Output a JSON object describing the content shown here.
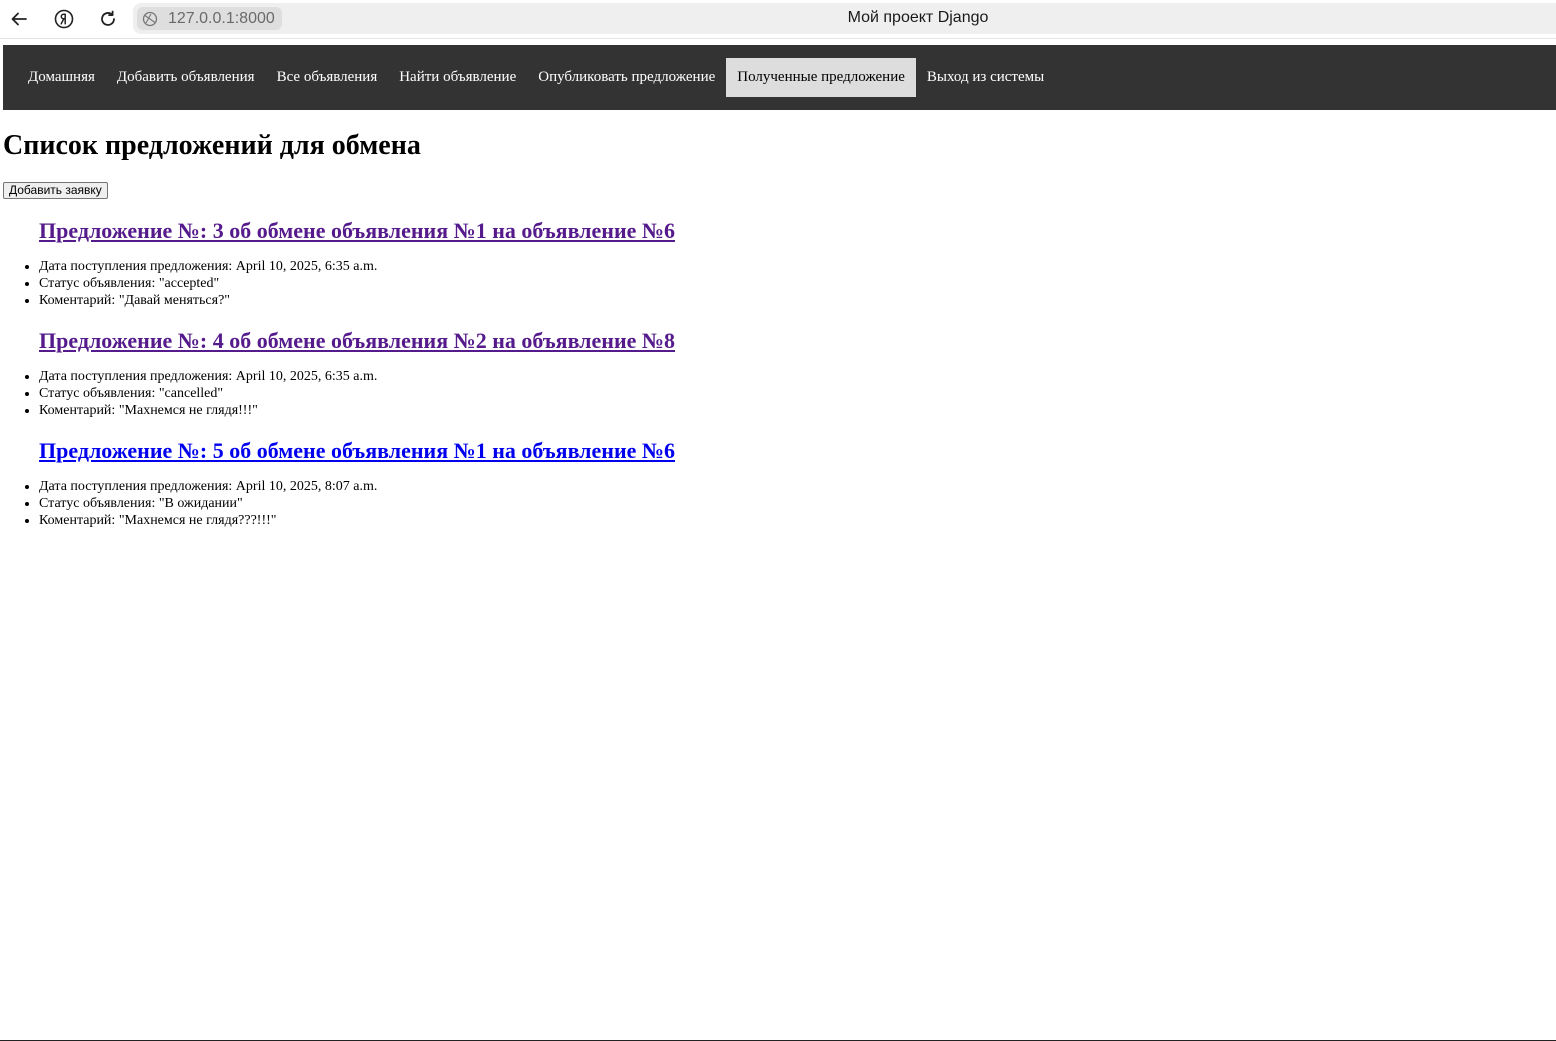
{
  "browser": {
    "url": "127.0.0.1:8000",
    "tab_title": "Мой проект Django"
  },
  "nav": {
    "items": [
      {
        "label": "Домашняя",
        "active": false
      },
      {
        "label": "Добавить объявления",
        "active": false
      },
      {
        "label": "Все объявления",
        "active": false
      },
      {
        "label": "Найти объявление",
        "active": false
      },
      {
        "label": "Опубликовать предложение",
        "active": false
      },
      {
        "label": "Полученные предложение",
        "active": true
      },
      {
        "label": "Выход из системы",
        "active": false
      }
    ]
  },
  "page": {
    "title": "Список предложений для обмена",
    "add_button": "Добавить заявку"
  },
  "offers": [
    {
      "title": "Предложение №: 3 об обмене объявления №1 на объявление №6",
      "visited": true,
      "date": "Дата поступления предложения: April 10, 2025, 6:35 a.m.",
      "status": "Статус объявления: \"accepted\"",
      "comment": "Коментарий: \"Давай меняться?\""
    },
    {
      "title": "Предложение №: 4 об обмене объявления №2 на объявление №8",
      "visited": true,
      "date": "Дата поступления предложения: April 10, 2025, 6:35 a.m.",
      "status": "Статус объявления: \"cancelled\"",
      "comment": "Коментарий: \"Махнемся не глядя!!!\""
    },
    {
      "title": "Предложение №: 5 об обмене объявления №1 на объявление №6",
      "visited": false,
      "date": "Дата поступления предложения: April 10, 2025, 8:07 a.m.",
      "status": "Статус объявления: \"В ожидании\"",
      "comment": "Коментарий: \"Махнемся не глядя???!!!\""
    }
  ],
  "colors": {
    "nav_bg": "#333333",
    "nav_active_bg": "#dddddd",
    "visited_link": "#551a8b",
    "link": "#0000ee"
  }
}
